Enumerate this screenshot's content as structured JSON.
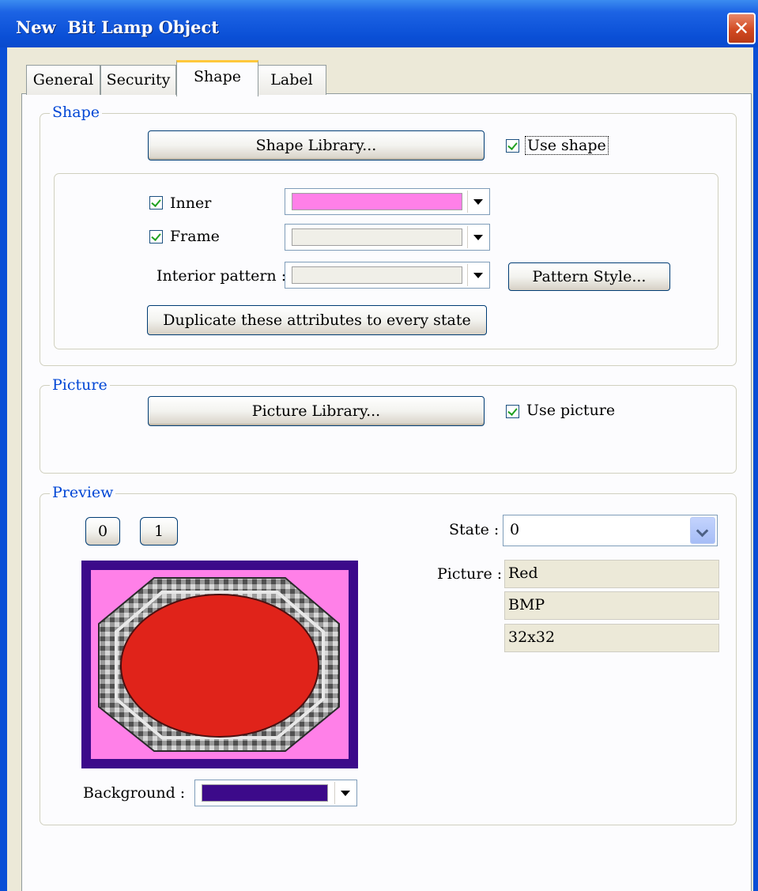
{
  "window": {
    "title": "New  Bit Lamp Object"
  },
  "tabs": [
    {
      "label": "General"
    },
    {
      "label": "Security"
    },
    {
      "label": "Shape"
    },
    {
      "label": "Label"
    }
  ],
  "shape_group": {
    "legend": "Shape",
    "library_button": "Shape Library...",
    "use_shape_label": "Use shape",
    "inner_label": "Inner",
    "inner_color": "#ff80e8",
    "frame_label": "Frame",
    "frame_color": "#f0efe8",
    "interior_pattern_label": "Interior pattern :",
    "pattern_color": "#f0efe8",
    "pattern_style_button": "Pattern Style...",
    "duplicate_button": "Duplicate these attributes to every state"
  },
  "picture_group": {
    "legend": "Picture",
    "library_button": "Picture Library...",
    "use_picture_label": "Use picture"
  },
  "preview_group": {
    "legend": "Preview",
    "state_buttons": [
      "0",
      "1"
    ],
    "state_label": "State :",
    "state_value": "0",
    "picture_label": "Picture :",
    "picture_name": "Red",
    "picture_format": "BMP",
    "picture_size": "32x32",
    "background_label": "Background :",
    "background_color": "#3c0a8a",
    "lamp_fill_color": "#e0231a",
    "lamp_background_color": "#ff80e8"
  }
}
